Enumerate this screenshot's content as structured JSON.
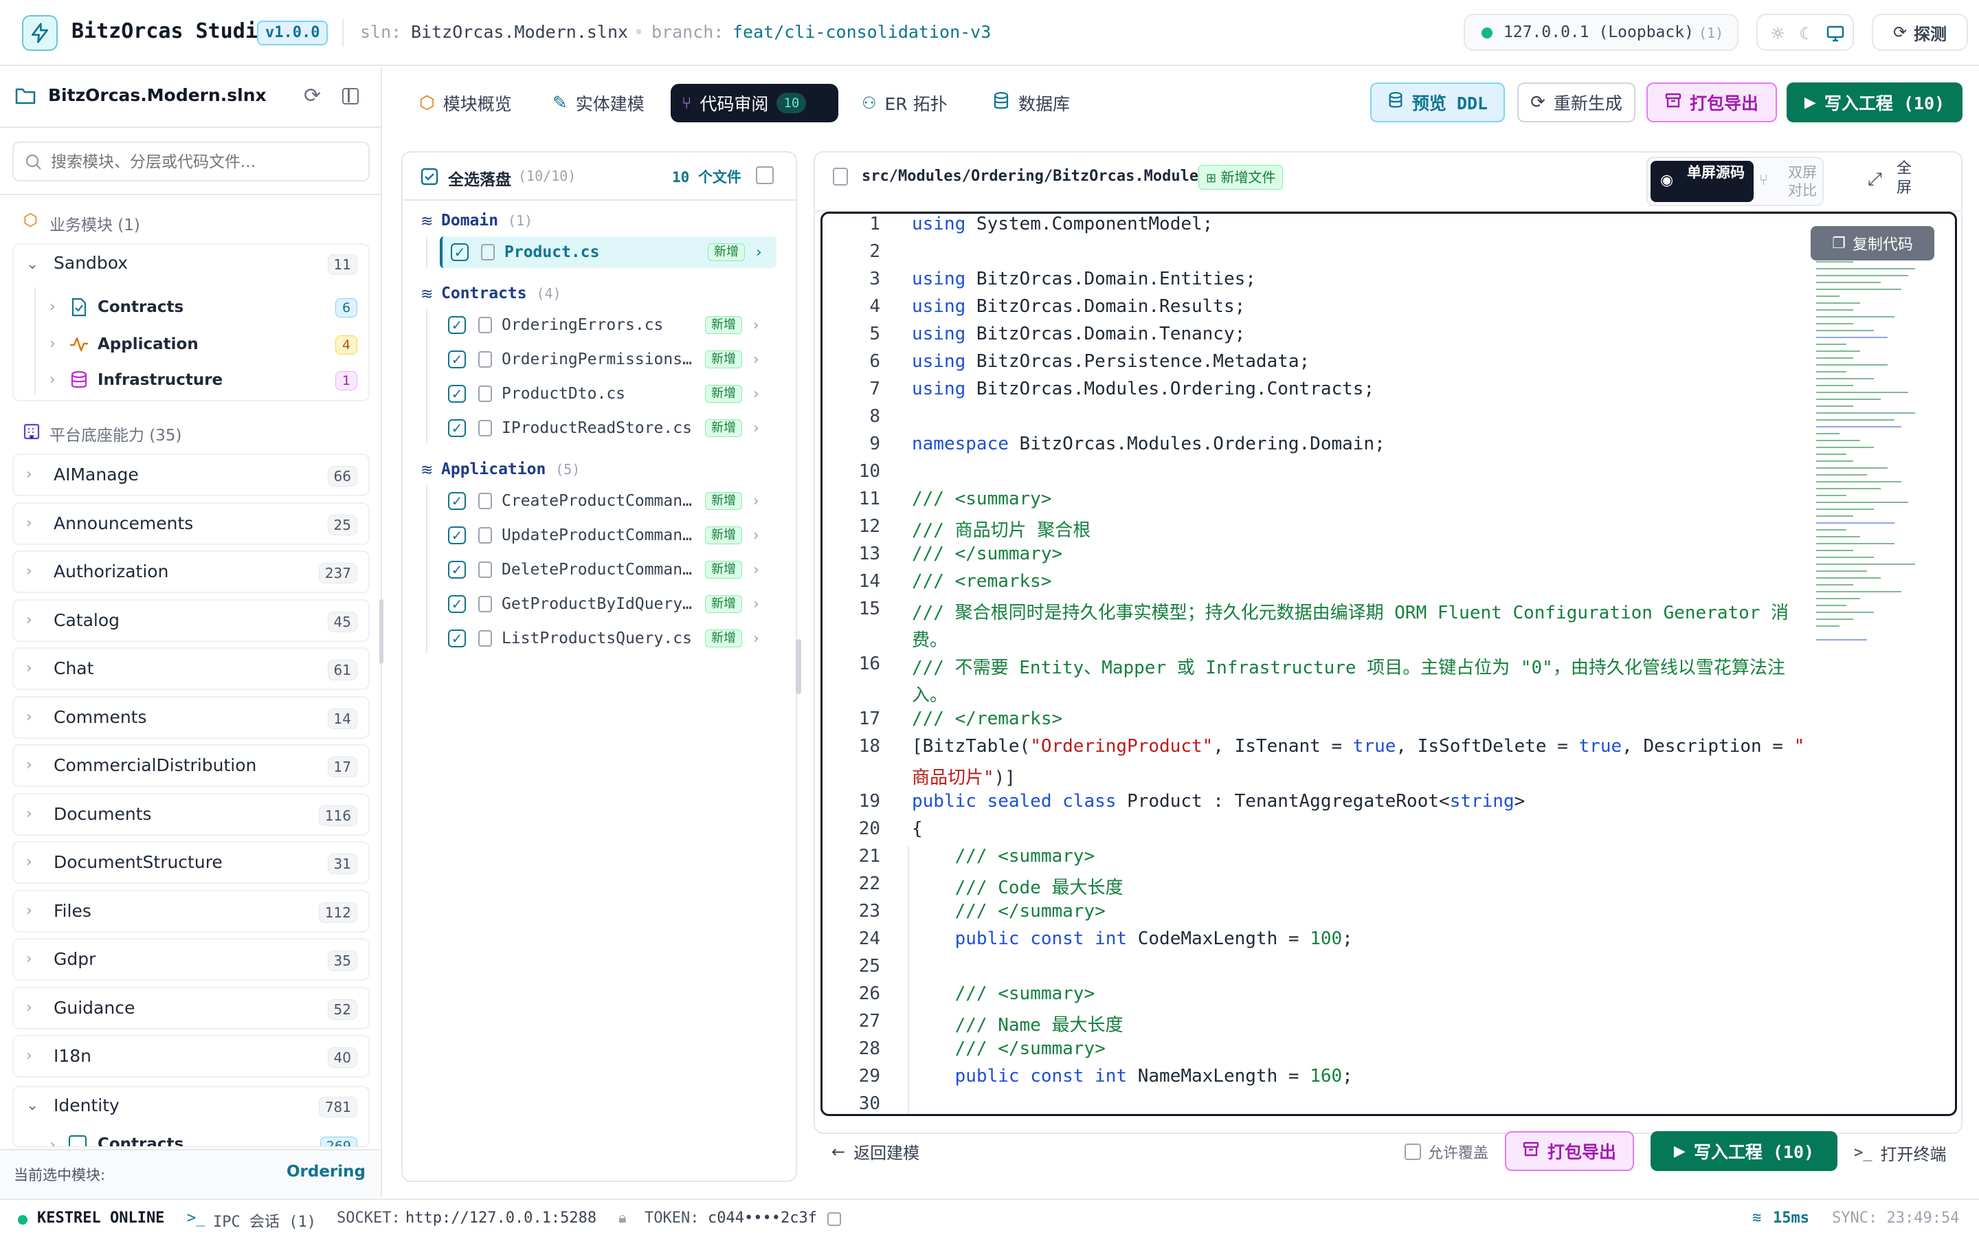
{
  "header": {
    "app_title": "BitzOrcas Studio",
    "version": "v1.0.0",
    "sln_label": "sln:",
    "sln_value": "BitzOrcas.Modern.slnx",
    "branch_label": "branch:",
    "branch_value": "feat/cli-consolidation-v3",
    "host": "127.0.0.1 (Loopback)",
    "host_count": "(1)",
    "probe_button": "探测"
  },
  "sidebar": {
    "solution": "BitzOrcas.Modern.slnx",
    "search_placeholder": "搜索模块、分层或代码文件...",
    "business_section": "业务模块 (1)",
    "sandbox": {
      "label": "Sandbox",
      "count": "11"
    },
    "sandbox_children": [
      {
        "label": "Contracts",
        "count": "6"
      },
      {
        "label": "Application",
        "count": "4"
      },
      {
        "label": "Infrastructure",
        "count": "1"
      }
    ],
    "platform_section": "平台底座能力 (35)",
    "modules": [
      {
        "label": "AIManage",
        "count": "66"
      },
      {
        "label": "Announcements",
        "count": "25"
      },
      {
        "label": "Authorization",
        "count": "237"
      },
      {
        "label": "Catalog",
        "count": "45"
      },
      {
        "label": "Chat",
        "count": "61"
      },
      {
        "label": "Comments",
        "count": "14"
      },
      {
        "label": "CommercialDistribution",
        "count": "17"
      },
      {
        "label": "Documents",
        "count": "116"
      },
      {
        "label": "DocumentStructure",
        "count": "31"
      },
      {
        "label": "Files",
        "count": "112"
      },
      {
        "label": "Gdpr",
        "count": "35"
      },
      {
        "label": "Guidance",
        "count": "52"
      },
      {
        "label": "I18n",
        "count": "40"
      },
      {
        "label": "Identity",
        "count": "781"
      }
    ],
    "identity_child": {
      "label": "Contracts",
      "count": "269"
    },
    "footer_label": "当前选中模块:",
    "footer_value": "Ordering"
  },
  "tabs": [
    {
      "label": "模块概览"
    },
    {
      "label": "实体建模"
    },
    {
      "label": "代码审阅",
      "badge": "10"
    },
    {
      "label": "ER 拓扑"
    },
    {
      "label": "数据库"
    }
  ],
  "toolbar": {
    "preview_ddl": "预览 DDL",
    "regenerate": "重新生成",
    "export_pack": "打包导出",
    "write_project": "写入工程 (10)"
  },
  "files": {
    "select_all": "全选落盘",
    "select_count": "(10/10)",
    "file_count": "10 个文件",
    "groups": [
      {
        "name": "Domain",
        "count": "(1)",
        "items": [
          {
            "name": "Product.cs",
            "tag": "新增"
          }
        ]
      },
      {
        "name": "Contracts",
        "count": "(4)",
        "items": [
          {
            "name": "OrderingErrors.cs",
            "tag": "新增"
          },
          {
            "name": "OrderingPermissions.cs",
            "tag": "新增"
          },
          {
            "name": "ProductDto.cs",
            "tag": "新增"
          },
          {
            "name": "IProductReadStore.cs",
            "tag": "新增"
          }
        ]
      },
      {
        "name": "Application",
        "count": "(5)",
        "items": [
          {
            "name": "CreateProductCommand.cs",
            "tag": "新增"
          },
          {
            "name": "UpdateProductCommand.cs",
            "tag": "新增"
          },
          {
            "name": "DeleteProductCommand.cs",
            "tag": "新增"
          },
          {
            "name": "GetProductByIdQuery.cs",
            "tag": "新增"
          },
          {
            "name": "ListProductsQuery.cs",
            "tag": "新增"
          }
        ]
      }
    ]
  },
  "editor": {
    "path": "src/Modules/Ordering/BitzOrcas.Modules.Ordering.Contracts/Domain/Product...",
    "new_file_tag": "新增文件",
    "single_view": "单屏源码",
    "diff_view": "双屏对比",
    "fullscreen": "全屏",
    "copy_code": "复制代码"
  },
  "bottom": {
    "back": "返回建模",
    "allow_overwrite": "允许覆盖",
    "export_pack": "打包导出",
    "write_project": "写入工程 (10)",
    "open_terminal": "打开终端"
  },
  "status": {
    "server": "KESTREL ONLINE",
    "ipc": "IPC 会话 (1)",
    "socket_label": "SOCKET:",
    "socket_value": "http://127.0.0.1:5288",
    "token_label": "TOKEN:",
    "token_value": "c044••••2c3f",
    "latency": "15ms",
    "sync": "SYNC: 23:49:54"
  },
  "colors": {
    "accent": "#0e7490",
    "primary_green": "#047857",
    "dark_tab": "#111827",
    "purple": "#a21caf"
  }
}
